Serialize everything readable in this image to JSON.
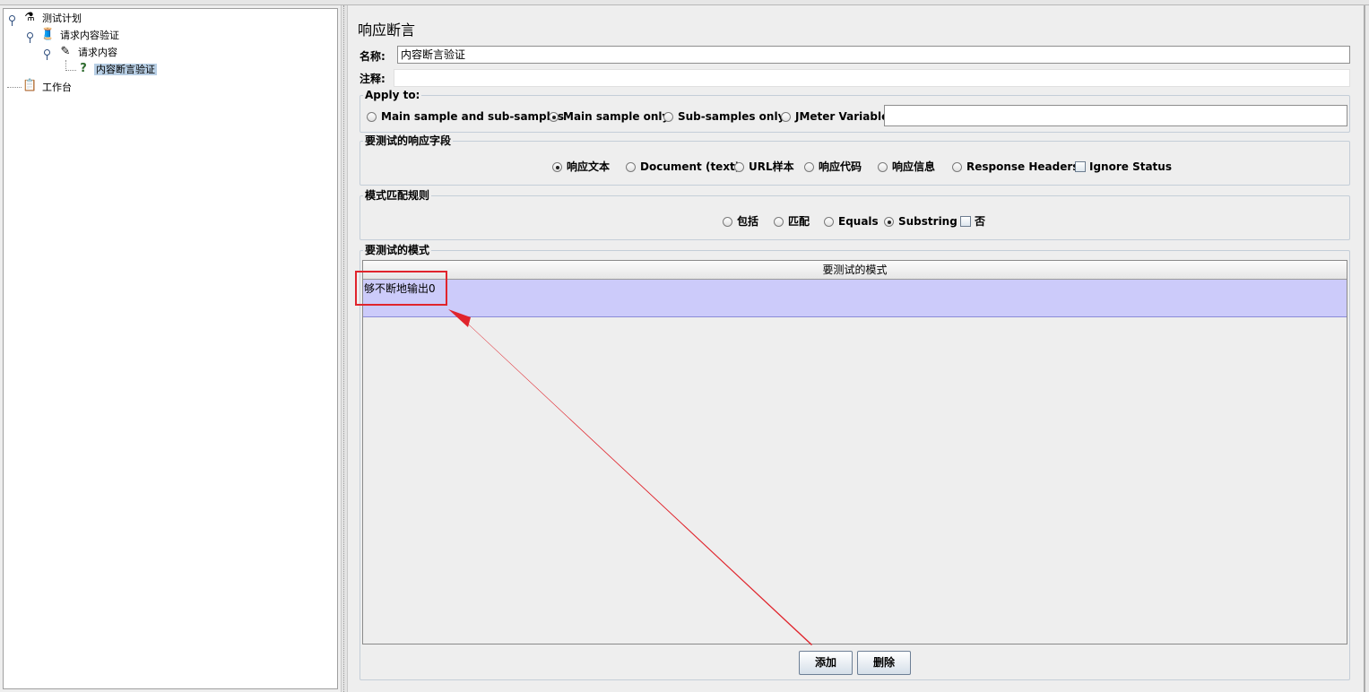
{
  "tree": {
    "items": [
      {
        "label": "测试计划",
        "icon": "flask-icon"
      },
      {
        "label": "请求内容验证",
        "icon": "thread-group-spool-icon"
      },
      {
        "label": "请求内容",
        "icon": "sampler-pipette-icon"
      },
      {
        "label": "内容断言验证",
        "icon": "assertion-question-icon"
      },
      {
        "label": "工作台",
        "icon": "workbench-clipboard-icon"
      }
    ]
  },
  "panel": {
    "title": "响应断言",
    "name_label": "名称:",
    "name_value": "内容断言验证",
    "comment_label": "注释:",
    "comment_value": ""
  },
  "apply_to": {
    "title": "Apply to:",
    "options": [
      "Main sample and sub-samples",
      "Main sample only",
      "Sub-samples only",
      "JMeter Variable"
    ],
    "selected": "Main sample only",
    "variable_value": ""
  },
  "response_field": {
    "title": "要测试的响应字段",
    "options": [
      "响应文本",
      "Document (text)",
      "URL样本",
      "响应代码",
      "响应信息",
      "Response Headers"
    ],
    "selected": "响应文本",
    "ignore_status_label": "Ignore Status",
    "ignore_status_checked": false
  },
  "pattern_rules": {
    "title": "模式匹配规则",
    "options": [
      "包括",
      "匹配",
      "Equals",
      "Substring"
    ],
    "selected": "Substring",
    "not_label": "否",
    "not_checked": false
  },
  "patterns": {
    "title": "要测试的模式",
    "column_header": "要测试的模式",
    "rows": [
      "够不断地输出0"
    ]
  },
  "buttons": {
    "add_label": "添加",
    "delete_label": "删除"
  },
  "colors": {
    "selected_row": "#cccbfa",
    "annotation": "#e0242c",
    "tree_selection": "#b8cfe5"
  }
}
